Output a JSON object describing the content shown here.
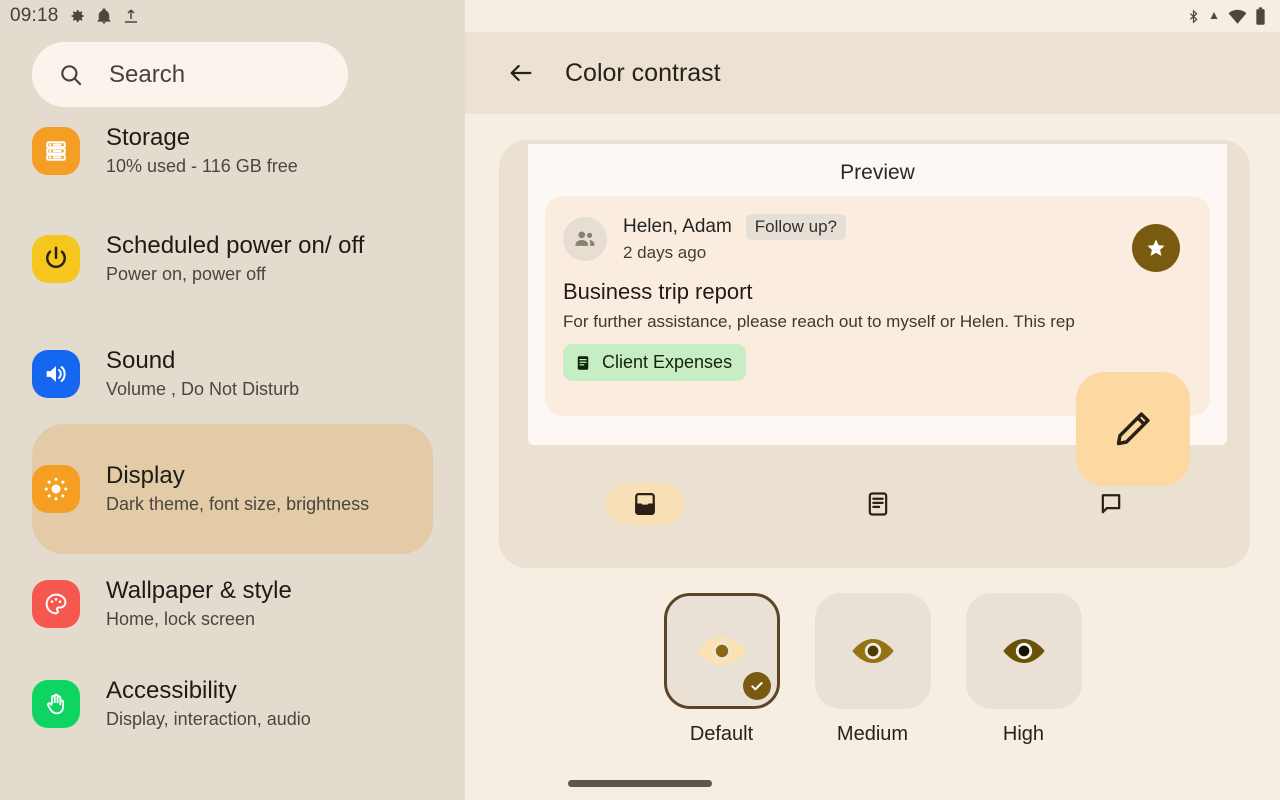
{
  "theme": {
    "left_bg": "#E3DBCE",
    "right_bg": "#F6EDE3",
    "topbar_bg": "#EDE2D2",
    "accent_brown": "#7A5A0E",
    "fab_peach": "#FBD9A0",
    "chip_green": "#C6EDC4",
    "highlight_tan": "#E2CBA6"
  },
  "status_bar": {
    "clock": "09:18",
    "left_icons": [
      "gear-icon",
      "bell-icon",
      "upload-icon"
    ],
    "right_icons": [
      "bluetooth-icon",
      "wifi-icon",
      "battery-icon"
    ]
  },
  "search": {
    "placeholder": "Search",
    "icon": "search-icon"
  },
  "sidebar": {
    "items": [
      {
        "id": "storage",
        "title": "Storage",
        "subtitle": "10% used - 116 GB free",
        "icon": "storage-icon",
        "icon_color": "#F59E24",
        "selected": false
      },
      {
        "id": "scheduled-power",
        "title": "Scheduled power on/ off",
        "subtitle": "Power on, power off",
        "icon": "power-icon",
        "icon_color": "#F5C61E",
        "selected": false
      },
      {
        "id": "sound",
        "title": "Sound",
        "subtitle": "Volume , Do Not Disturb",
        "icon": "speaker-icon",
        "icon_color": "#1667F0",
        "selected": false
      },
      {
        "id": "display",
        "title": "Display",
        "subtitle": "Dark theme, font size, brightness",
        "icon": "brightness-icon",
        "icon_color": "#F59E24",
        "selected": true
      },
      {
        "id": "wallpaper-style",
        "title": "Wallpaper & style",
        "subtitle": "Home, lock screen",
        "icon": "palette-icon",
        "icon_color": "#F6574E",
        "selected": false
      },
      {
        "id": "accessibility",
        "title": "Accessibility",
        "subtitle": "Display, interaction, audio",
        "icon": "hand-icon",
        "icon_color": "#0FD461",
        "selected": false
      }
    ]
  },
  "header": {
    "title": "Color contrast",
    "back_icon": "back-arrow-icon"
  },
  "preview": {
    "label": "Preview",
    "message": {
      "sender": "Helen, Adam",
      "chip": "Follow up?",
      "time": "2 days ago",
      "subject": "Business trip report",
      "snippet": "For further assistance, please reach out to myself or Helen. This rep",
      "label_chip": "Client Expenses",
      "label_chip_icon": "label-document-icon",
      "avatar_icon": "people-icon"
    },
    "star_button_icon": "star-icon",
    "edit_button_icon": "pencil-icon",
    "nav": [
      {
        "id": "inbox",
        "icon": "inbox-icon",
        "selected": true
      },
      {
        "id": "articles",
        "icon": "article-icon",
        "selected": false
      },
      {
        "id": "chat",
        "icon": "chat-bubble-icon",
        "selected": false
      }
    ]
  },
  "contrast_options": [
    {
      "id": "default",
      "label": "Default",
      "icon": "eye-icon",
      "eye_color": "#FBE2B0",
      "pupil_color": "#8A6913",
      "selected": true
    },
    {
      "id": "medium",
      "label": "Medium",
      "icon": "eye-icon",
      "eye_color": "#937314",
      "pupil_color": "#4E3A06",
      "selected": false
    },
    {
      "id": "high",
      "label": "High",
      "icon": "eye-icon",
      "eye_color": "#6B5208",
      "pupil_color": "#1A1204",
      "selected": false
    }
  ]
}
